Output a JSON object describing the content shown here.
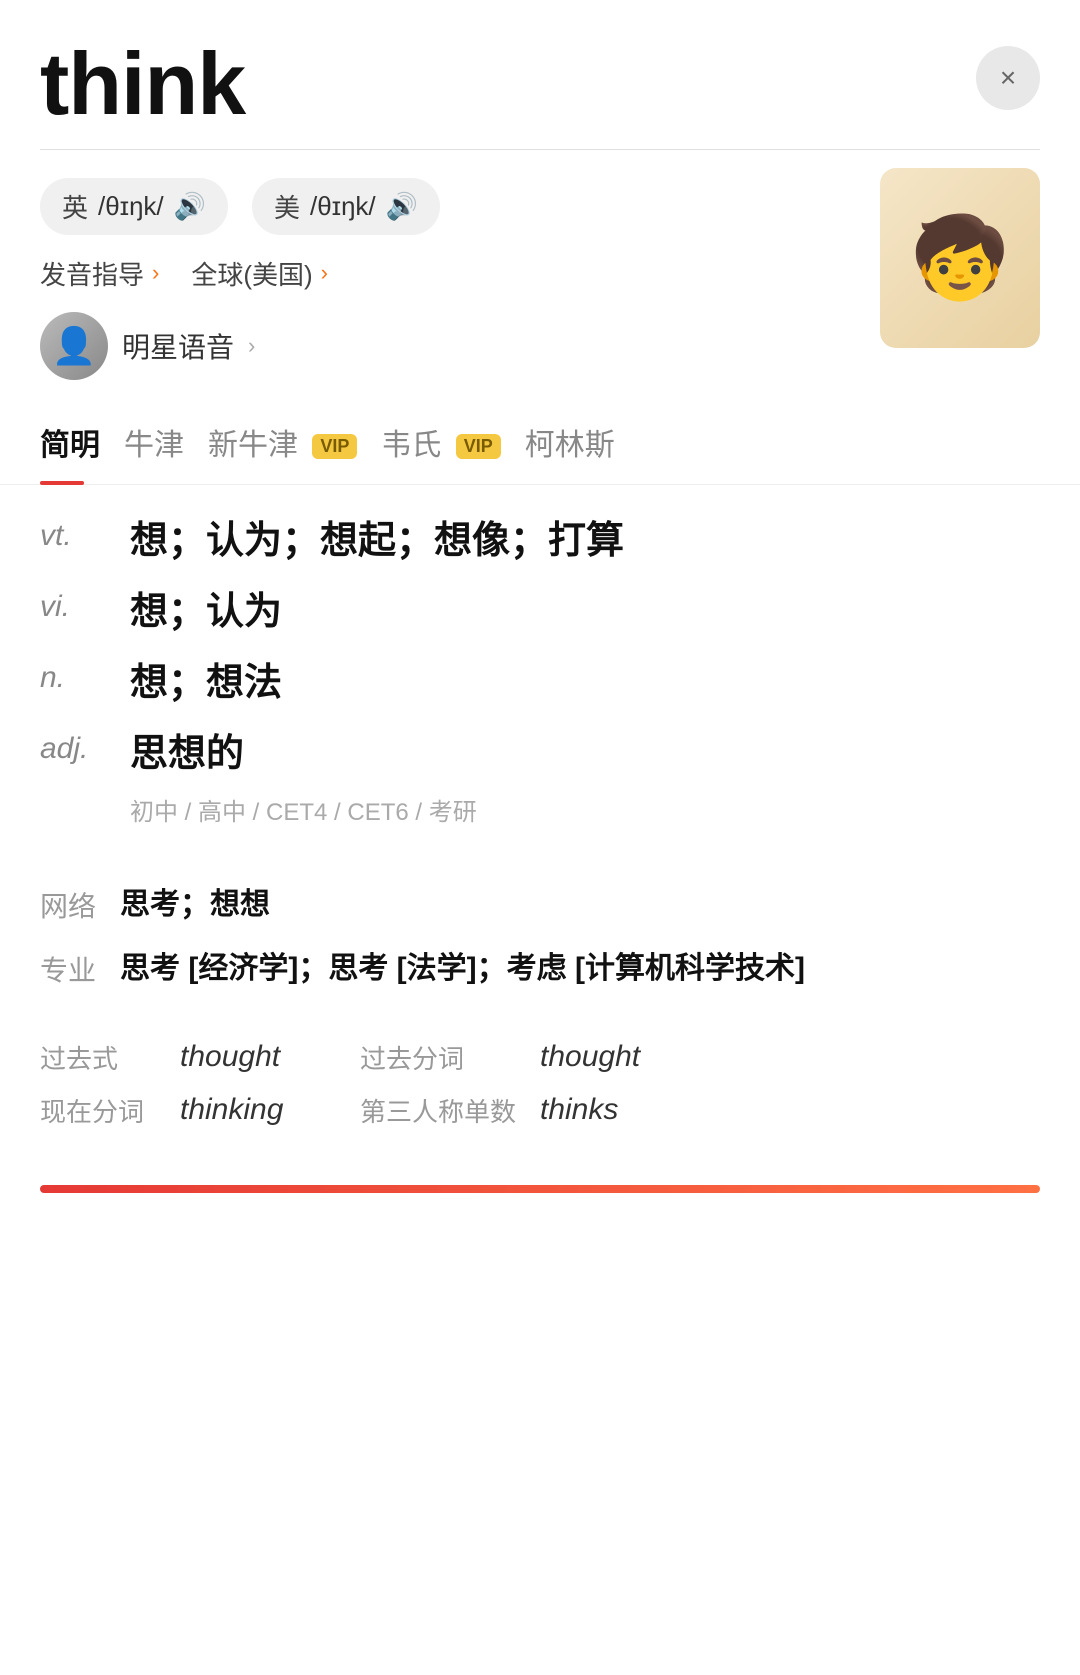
{
  "header": {
    "word": "think",
    "close_label": "×"
  },
  "phonetics": {
    "british_label": "英",
    "british_ipa": "/θɪŋk/",
    "american_label": "美",
    "american_ipa": "/θɪŋk/",
    "sound_icon": "🔊",
    "guide_label": "发音指导",
    "global_label": "全球(美国)",
    "star_voice_label": "明星语音",
    "star_voice_arrow": "›"
  },
  "tabs": [
    {
      "label": "简明",
      "active": true,
      "vip": false
    },
    {
      "label": "牛津",
      "active": false,
      "vip": false
    },
    {
      "label": "新牛津",
      "active": false,
      "vip": true
    },
    {
      "label": "韦氏",
      "active": false,
      "vip": true
    },
    {
      "label": "柯林斯",
      "active": false,
      "vip": false
    }
  ],
  "definitions": [
    {
      "pos": "vt.",
      "text": "想；认为；想起；想像；打算"
    },
    {
      "pos": "vi.",
      "text": "想；认为"
    },
    {
      "pos": "n.",
      "text": "想；想法"
    },
    {
      "pos": "adj.",
      "text": "思想的"
    }
  ],
  "levels": "初中 / 高中 / CET4 / CET6 / 考研",
  "extra": [
    {
      "label": "网络",
      "text": "思考；想想"
    },
    {
      "label": "专业",
      "text": "思考 [经济学]；思考 [法学]；考虑 [计算机科学技术]"
    }
  ],
  "forms": [
    {
      "label": "过去式",
      "value": "thought",
      "label2": "过去分词",
      "value2": "thought"
    },
    {
      "label": "现在分词",
      "value": "thinking",
      "label2": "第三人称单数",
      "value2": "thinks"
    }
  ]
}
